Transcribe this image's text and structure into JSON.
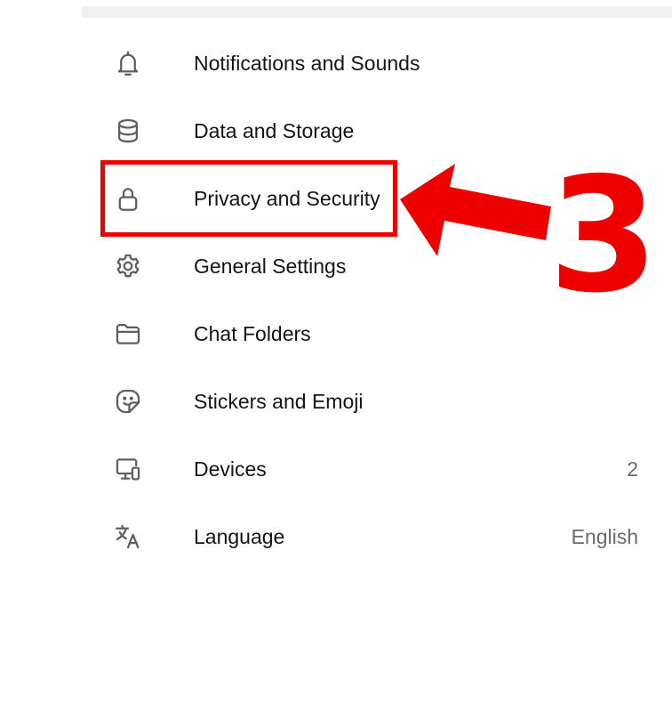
{
  "settings_menu": {
    "items": [
      {
        "icon": "bell-icon",
        "label": "Notifications and Sounds",
        "value": ""
      },
      {
        "icon": "database-icon",
        "label": "Data and Storage",
        "value": ""
      },
      {
        "icon": "lock-icon",
        "label": "Privacy and Security",
        "value": ""
      },
      {
        "icon": "gear-icon",
        "label": "General Settings",
        "value": ""
      },
      {
        "icon": "folder-icon",
        "label": "Chat Folders",
        "value": ""
      },
      {
        "icon": "sticker-icon",
        "label": "Stickers and Emoji",
        "value": ""
      },
      {
        "icon": "devices-icon",
        "label": "Devices",
        "value": "2"
      },
      {
        "icon": "translate-icon",
        "label": "Language",
        "value": "English"
      }
    ]
  },
  "annotation": {
    "step_number": "3",
    "highlighted_item": "Privacy and Security",
    "color": "#ee0000"
  },
  "colors": {
    "icon": "#5f5f5f",
    "label": "#141414",
    "value": "#6b6b6b",
    "top_strip": "#f0f0f0"
  }
}
